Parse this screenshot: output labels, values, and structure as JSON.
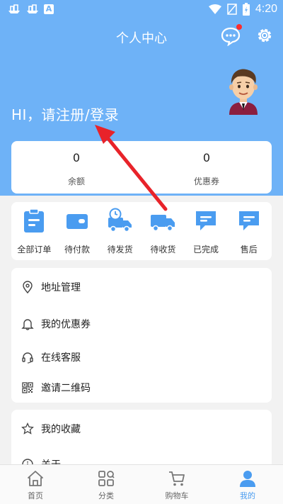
{
  "status_bar": {
    "time": "4:20",
    "app_icon_letter": "A"
  },
  "header": {
    "title": "个人中心",
    "greeting": "HI，请注册/登录"
  },
  "balance": [
    {
      "value": "0",
      "label": "余额"
    },
    {
      "value": "0",
      "label": "优惠券"
    }
  ],
  "orders": [
    {
      "label": "全部订单",
      "icon": "clipboard-icon"
    },
    {
      "label": "待付款",
      "icon": "wallet-icon"
    },
    {
      "label": "待发货",
      "icon": "delivery-clock-truck-icon"
    },
    {
      "label": "待收货",
      "icon": "truck-icon"
    },
    {
      "label": "已完成",
      "icon": "chat-done-icon"
    },
    {
      "label": "售后",
      "icon": "chat-service-icon"
    }
  ],
  "menu_a": [
    {
      "label": "地址管理",
      "icon": "location-pin-icon"
    },
    {
      "label": "我的优惠券",
      "icon": "bell-icon"
    },
    {
      "label": "在线客服",
      "icon": "headset-icon"
    },
    {
      "label": "邀请二维码",
      "icon": "qrcode-icon"
    }
  ],
  "menu_b": [
    {
      "label": "我的收藏",
      "icon": "star-icon"
    },
    {
      "label": "关于",
      "icon": "info-icon"
    }
  ],
  "tabs": [
    {
      "label": "首页",
      "icon": "home-icon",
      "active": false
    },
    {
      "label": "分类",
      "icon": "category-icon",
      "active": false
    },
    {
      "label": "购物车",
      "icon": "cart-icon",
      "active": false
    },
    {
      "label": "我的",
      "icon": "user-icon",
      "active": true
    }
  ],
  "colors": {
    "header_bg": "#6eb2f7",
    "accent": "#4a9cf0",
    "badge": "#ff2d2d"
  }
}
